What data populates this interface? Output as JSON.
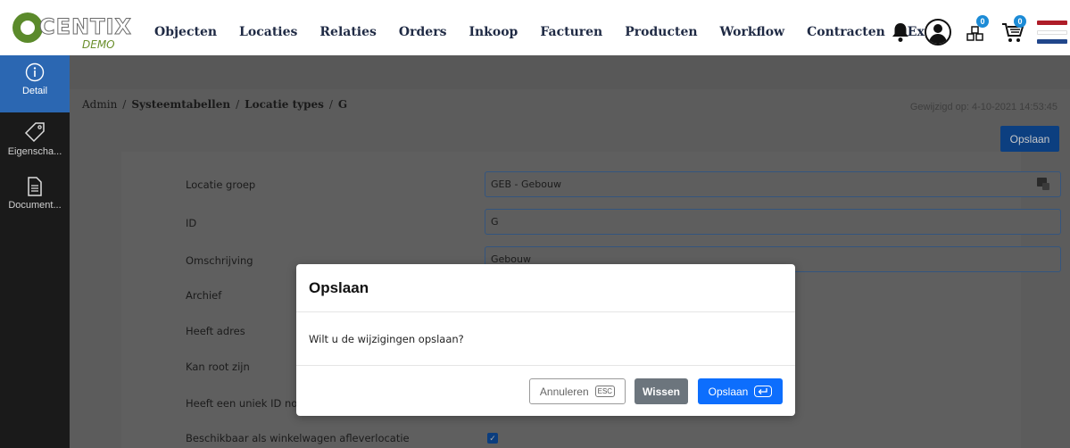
{
  "logo": {
    "brand": "CENTIX",
    "sub": "DEMO"
  },
  "nav": {
    "items": [
      "Objecten",
      "Locaties",
      "Relaties",
      "Orders",
      "Inkoop",
      "Facturen",
      "Producten",
      "Workflow",
      "Contracten",
      "Extra"
    ],
    "badges": {
      "orders": "0",
      "cart": "0"
    }
  },
  "sidebar": {
    "items": [
      {
        "label": "Detail",
        "icon": "info-icon"
      },
      {
        "label": "Eigenscha...",
        "icon": "tag-icon"
      },
      {
        "label": "Document...",
        "icon": "document-icon"
      }
    ]
  },
  "breadcrumb": [
    "Admin",
    "Systeemtabellen",
    "Locatie types",
    "G"
  ],
  "modified": "Gewijzigd op: 4-10-2021 14:53:45",
  "save_button": "Opslaan",
  "form": {
    "labels": [
      "Locatie groep",
      "ID",
      "Omschrijving",
      "Archief",
      "Heeft adres",
      "Kan root zijn",
      "Heeft een uniek ID nodig",
      "Beschikbaar als winkelwagen afleverlocatie"
    ],
    "values": {
      "locatie_groep": "GEB - Gebouw",
      "id": "G",
      "omschrijving": "Gebouw"
    },
    "checked": {
      "winkelwagen": true
    }
  },
  "modal": {
    "title": "Opslaan",
    "message": "Wilt u de wijzigingen opslaan?",
    "cancel": "Annuleren",
    "cancel_key": "ESC",
    "clear": "Wissen",
    "save": "Opslaan"
  },
  "colors": {
    "sidebar_active": "#2b67b2",
    "primary": "#0d6efd",
    "secondary": "#6c757d",
    "flag_red": "#ae1c28",
    "flag_white": "#ffffff",
    "flag_blue": "#21468b"
  }
}
